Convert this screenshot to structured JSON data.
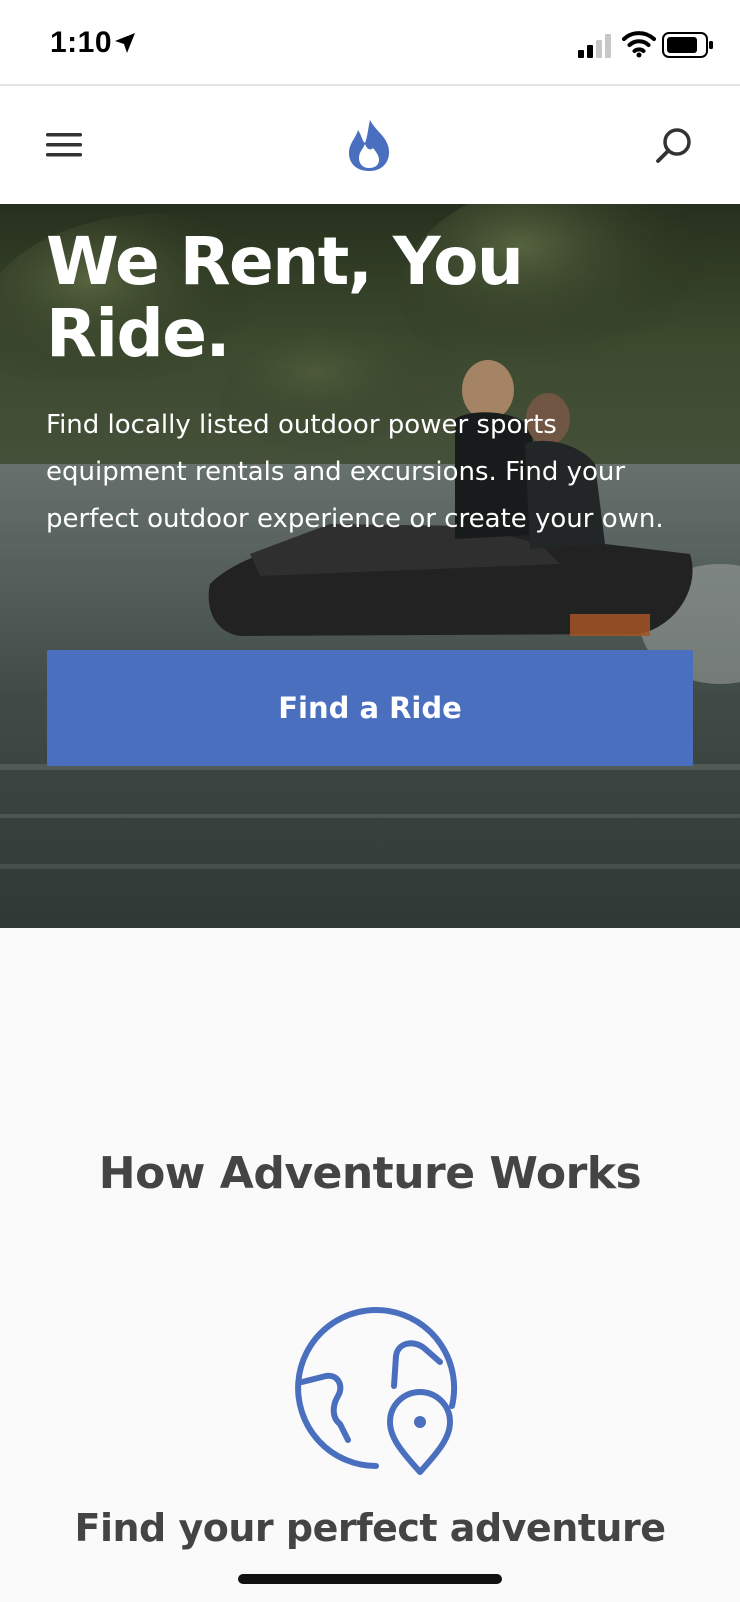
{
  "status_bar": {
    "time": "1:10",
    "icons": [
      "location-arrow-icon",
      "cellular-signal-icon",
      "wifi-icon",
      "battery-icon"
    ]
  },
  "header": {
    "menu_icon": "hamburger-menu-icon",
    "logo_icon": "flame-logo-icon",
    "search_icon": "search-icon"
  },
  "hero": {
    "title": "We Rent, You Ride.",
    "description": "Find locally listed outdoor power sports equipment rentals and excursions. Find your perfect outdoor experience or create your own.",
    "button_label": "Find a Ride"
  },
  "how_it_works": {
    "title": "How Adventure Works",
    "step_icon": "globe-location-pin-icon",
    "step_title": "Find your perfect adventure"
  },
  "colors": {
    "accent": "#4b6fbf",
    "heading_text": "#444444",
    "section_bg": "#fafafa",
    "header_bg": "#ffffff"
  }
}
